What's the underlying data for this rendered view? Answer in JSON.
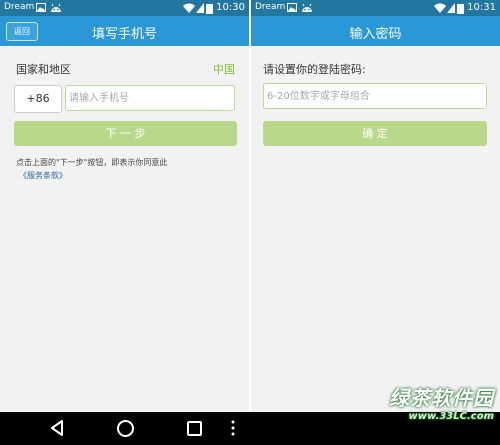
{
  "left": {
    "statusbar": {
      "carrier": "Dream",
      "time": "10:30"
    },
    "header": {
      "back_label": "返回",
      "title": "填写手机号"
    },
    "region": {
      "label": "国家和地区",
      "value": "中国"
    },
    "phone": {
      "code": "+86",
      "placeholder": "请输入手机号"
    },
    "next_button": "下 一 步",
    "notice": "点击上面的\"下一步\"按钮，即表示你同意此",
    "terms_link": "《服务条款》"
  },
  "right": {
    "statusbar": {
      "carrier": "Dream",
      "time": "10:31"
    },
    "header": {
      "title": "输入密码"
    },
    "prompt": "请设置你的登陆密码:",
    "password": {
      "placeholder": "6-20位数字或字母组合"
    },
    "confirm_button": "确 定"
  },
  "watermark": {
    "text": "绿茶软件园",
    "url": "www.33LC.com"
  },
  "colors": {
    "statusbar": "#21779f",
    "titlebar": "#2a97d6",
    "accent_green": "#7fbf2a",
    "button_green": "#b8d98a",
    "link_blue": "#2a63a8"
  },
  "icons": [
    "image-icon",
    "android-icon",
    "wifi-icon",
    "signal-icon",
    "battery-icon",
    "nav-back-icon",
    "nav-home-icon",
    "nav-recent-icon",
    "nav-menu-icon"
  ]
}
